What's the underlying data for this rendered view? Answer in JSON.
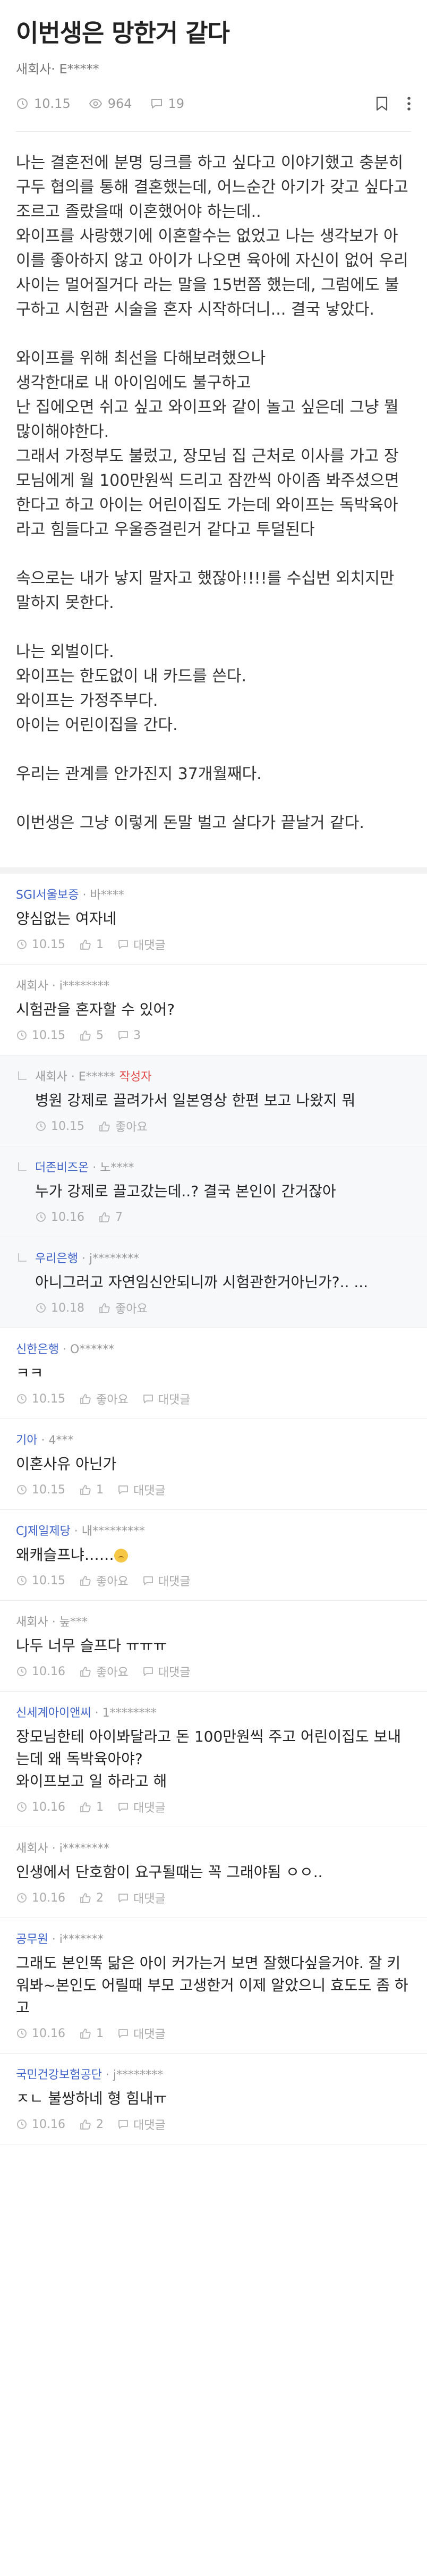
{
  "post": {
    "title": "이번생은 망한거 같다",
    "author": "새회사· E*****",
    "time": "10.15",
    "views": "964",
    "comments": "19",
    "paragraphs": [
      "나는 결혼전에 분명 딩크를 하고 싶다고 이야기했고 충분히 구두 협의를 통해 결혼했는데, 어느순간 아기가 갖고 싶다고 조르고 졸랐을때 이혼했어야 하는데..\n와이프를 사랑했기에 이혼할수는 없었고 나는 생각보가 아이를 좋아하지 않고 아이가 나오면 육아에 자신이 없어 우리 사이는 멀어질거다 라는 말을 15번쯤 했는데, 그럼에도 불구하고 시험관 시술을 혼자 시작하더니... 결국 낳았다.",
      "와이프를 위해 최선을 다해보려했으나\n생각한대로 내 아이임에도 불구하고\n난 집에오면 쉬고 싶고 와이프와 같이 놀고 싶은데 그냥 뭘 많이해야한다.\n그래서 가정부도 불렀고, 장모님 집 근처로 이사를 가고 장모님에게 월 100만원씩 드리고 잠깐씩 아이좀 봐주셨으면 한다고 하고 아이는 어린이집도 가는데 와이프는 독박육아라고 힘들다고 우울증걸린거 같다고 투덜된다",
      "속으로는 내가 낳지 말자고 했잖아!!!!를 수십번 외치지만 말하지 못한다.",
      "나는 외벌이다.\n와이프는 한도없이 내 카드를 쓴다.\n와이프는 가정주부다.\n아이는 어린이집을 간다.",
      "우리는 관계를 안가진지 37개월째다.",
      "이번생은 그냥 이렇게 돈말 벌고 살다가 끝날거 같다."
    ]
  },
  "labels": {
    "like": "좋아요",
    "reply": "대댓글",
    "writer": "작성자"
  },
  "comments": [
    {
      "company": "SGI서울보증",
      "blue": true,
      "user": "· 바****",
      "text": "양심없는 여자네",
      "time": "10.15",
      "likes": "1",
      "replies": "",
      "reply": false,
      "writer": false,
      "emoji": false
    },
    {
      "company": "새회사",
      "blue": false,
      "user": "· i********",
      "text": "시험관을 혼자할 수 있어?",
      "time": "10.15",
      "likes": "5",
      "replies": "3",
      "reply": false,
      "writer": false,
      "emoji": false
    },
    {
      "company": "새회사",
      "blue": false,
      "user": "· E*****",
      "text": "병원 강제로 끌려가서 일본영상 한편 보고 나왔지 뭐",
      "time": "10.15",
      "likes": "",
      "replies": "",
      "reply": true,
      "writer": true,
      "emoji": false
    },
    {
      "company": "더존비즈온",
      "blue": true,
      "user": "· 노****",
      "text": "누가 강제로 끌고갔는데..? 결국 본인이 간거잖아",
      "time": "10.16",
      "likes": "7",
      "replies": "",
      "reply": true,
      "writer": false,
      "emoji": false
    },
    {
      "company": "우리은행",
      "blue": true,
      "user": "· j********",
      "text": "아니그러고 자연임신안되니까 시험관한거아닌가?.. ...",
      "time": "10.18",
      "likes": "",
      "replies": "",
      "reply": true,
      "writer": false,
      "emoji": false
    },
    {
      "company": "신한은행",
      "blue": true,
      "user": "· O******",
      "text": "ㅋㅋ",
      "time": "10.15",
      "likes": "",
      "replies": "",
      "reply": false,
      "writer": false,
      "emoji": false
    },
    {
      "company": "기아",
      "blue": true,
      "user": "· 4***",
      "text": "이혼사유 아닌가",
      "time": "10.15",
      "likes": "1",
      "replies": "",
      "reply": false,
      "writer": false,
      "emoji": false
    },
    {
      "company": "CJ제일제당",
      "blue": true,
      "user": "· 내*********",
      "text": "왜캐슬프냐……",
      "time": "10.15",
      "likes": "",
      "replies": "",
      "reply": false,
      "writer": false,
      "emoji": true
    },
    {
      "company": "새회사",
      "blue": false,
      "user": "· 눞***",
      "text": "나두 너무 슬프다 ㅠㅠㅠ",
      "time": "10.16",
      "likes": "",
      "replies": "",
      "reply": false,
      "writer": false,
      "emoji": false
    },
    {
      "company": "신세계아이앤씨",
      "blue": true,
      "user": "· 1********",
      "text": "장모님한테 아이봐달라고 돈 100만원씩 주고 어린이집도 보내는데 왜 독박육아야?\n와이프보고 일 하라고 해",
      "time": "10.16",
      "likes": "1",
      "replies": "",
      "reply": false,
      "writer": false,
      "emoji": false
    },
    {
      "company": "새회사",
      "blue": false,
      "user": "· i********",
      "text": "인생에서 단호함이 요구될때는 꼭 그래야됨 ㅇㅇ..",
      "time": "10.16",
      "likes": "2",
      "replies": "",
      "reply": false,
      "writer": false,
      "emoji": false
    },
    {
      "company": "공무원",
      "blue": true,
      "user": "· i*******",
      "text": "그래도 본인똑 닮은 아이 커가는거 보면 잘했다싶을거야. 잘 키워봐~본인도 어릴때 부모 고생한거 이제 알았으니 효도도 좀 하고",
      "time": "10.16",
      "likes": "1",
      "replies": "",
      "reply": false,
      "writer": false,
      "emoji": false
    },
    {
      "company": "국민건강보험공단",
      "blue": true,
      "user": "· j********",
      "text": "ㅈㄴ 불쌍하네 형 힘내ㅠ",
      "time": "10.16",
      "likes": "2",
      "replies": "",
      "reply": false,
      "writer": false,
      "emoji": false
    }
  ]
}
